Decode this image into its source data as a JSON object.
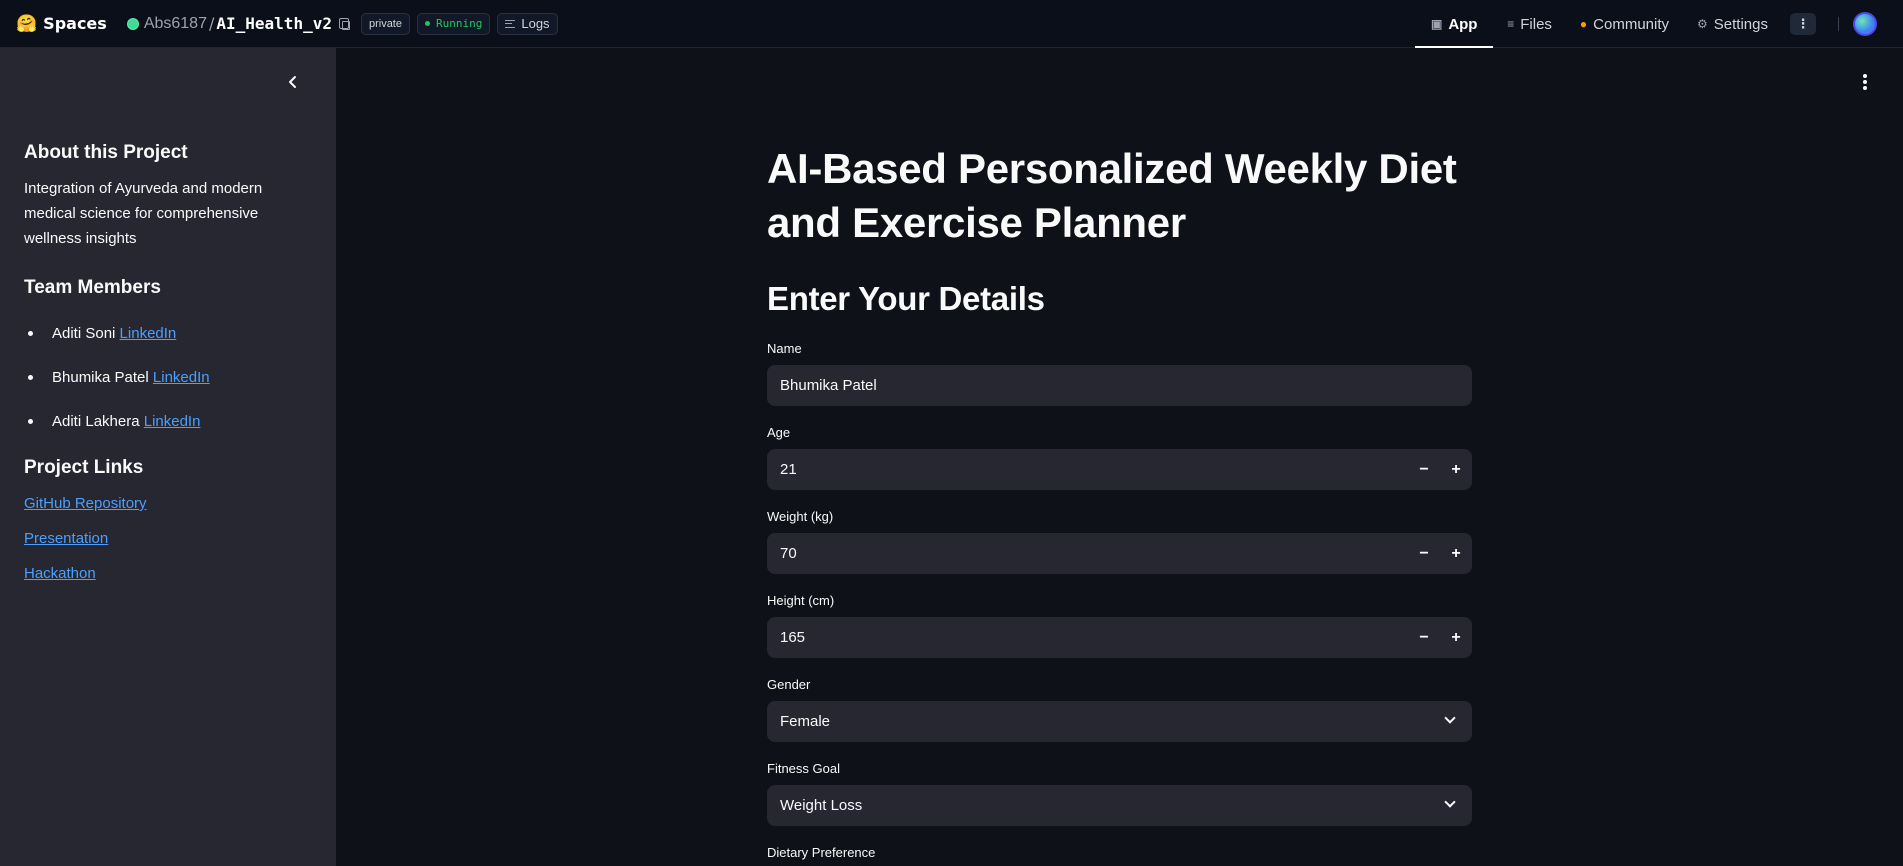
{
  "topbar": {
    "brand_icon": "🤗",
    "brand": "Spaces",
    "owner": "Abs6187",
    "slash": "/",
    "repo": "AI_Health_v2",
    "visibility": "private",
    "status": "Running",
    "logs": "Logs"
  },
  "nav": {
    "app": "App",
    "files": "Files",
    "community": "Community",
    "settings": "Settings",
    "app_icon": "cube-icon",
    "files_icon": "files-icon",
    "community_icon": "community-icon",
    "settings_icon": "gear-icon"
  },
  "sidebar": {
    "about_heading": "About this Project",
    "about_text": "Integration of Ayurveda and modern medical science for comprehensive wellness insights",
    "team_heading": "Team Members",
    "members": [
      {
        "name": "Aditi Soni",
        "link": "LinkedIn"
      },
      {
        "name": "Bhumika Patel",
        "link": "LinkedIn"
      },
      {
        "name": "Aditi Lakhera",
        "link": "LinkedIn"
      }
    ],
    "links_heading": "Project Links",
    "links": [
      "GitHub Repository",
      "Presentation",
      "Hackathon"
    ]
  },
  "main": {
    "title": "AI-Based Personalized Weekly Diet and Exercise Planner",
    "subtitle": "Enter Your Details",
    "fields": {
      "name": {
        "label": "Name",
        "value": "Bhumika Patel"
      },
      "age": {
        "label": "Age",
        "value": "21"
      },
      "weight": {
        "label": "Weight (kg)",
        "value": "70"
      },
      "height": {
        "label": "Height (cm)",
        "value": "165"
      },
      "gender": {
        "label": "Gender",
        "value": "Female"
      },
      "goal": {
        "label": "Fitness Goal",
        "value": "Weight Loss"
      },
      "diet": {
        "label": "Dietary Preference"
      }
    },
    "minus": "−",
    "plus": "+"
  },
  "colors": {
    "background": "#0e1117",
    "sidebar": "#262730",
    "input": "#262730",
    "link": "#4b9fff",
    "running": "#22c55e"
  }
}
